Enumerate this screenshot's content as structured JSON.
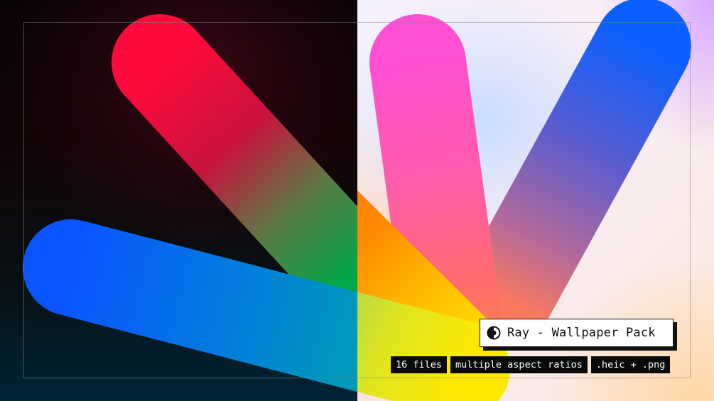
{
  "card": {
    "title": "Ray - Wallpaper Pack",
    "logo_icon": "ray-logo-icon"
  },
  "tags": [
    "16 files",
    "multiple aspect ratios",
    ".heic + .png"
  ],
  "colors": {
    "card_background": "#ffffff",
    "tag_background": "#0a0a0a",
    "ray_red": "#ff0a3c",
    "ray_green": "#00a84a",
    "ray_blue": "#0a5cff",
    "ray_pink": "#ff55cc",
    "ray_yellow": "#ffe600",
    "ray_orange": "#ff9a00"
  }
}
